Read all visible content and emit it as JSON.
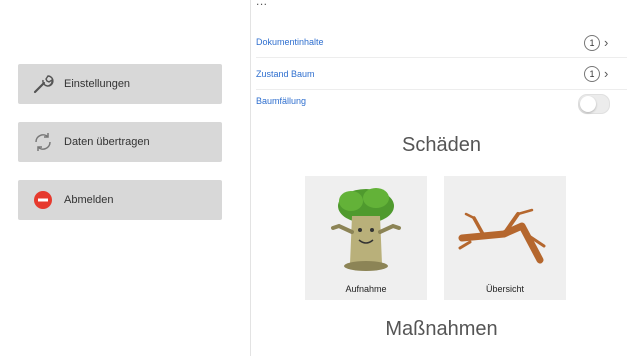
{
  "menu": {
    "settings_label": "Einstellungen",
    "transfer_label": "Daten übertragen",
    "logout_label": "Abmelden"
  },
  "panel": {
    "cut_off_text": "...",
    "rows": [
      {
        "label": "Dokumentinhalte",
        "count": "1"
      },
      {
        "label": "Zustand Baum",
        "count": "1"
      },
      {
        "label": "Baumfällung"
      }
    ],
    "damages_title": "Schäden",
    "tiles": [
      {
        "label": "Aufnahme"
      },
      {
        "label": "Übersicht"
      }
    ],
    "measures_title": "Maßnahmen"
  },
  "colors": {
    "menu_button_bg": "#d8d8d8",
    "link_blue": "#2f6fcf",
    "logout_red": "#e63a2e",
    "tile_bg": "#efefef"
  },
  "icons": [
    "wrench-icon",
    "sync-icon",
    "minus-circle-icon",
    "chevron-right-icon"
  ]
}
